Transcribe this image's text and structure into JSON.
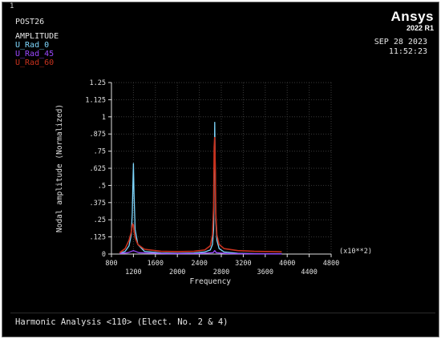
{
  "window_number": "1",
  "post_title": "POST26",
  "amplitude_label": "AMPLITUDE",
  "legend": [
    {
      "label": "U_Rad_0",
      "color": "#7fd8ff"
    },
    {
      "label": "U_Rad_45",
      "color": "#9b48ff"
    },
    {
      "label": "U_Rad_60",
      "color": "#c8321e"
    }
  ],
  "date": "SEP 28 2023",
  "time": "11:52:23",
  "logo": {
    "word": "Ansys",
    "version": "2022 R1"
  },
  "footer": "Harmonic Analysis <110> (Elect. No. 2 & 4)",
  "chart_data": {
    "type": "line",
    "xlabel": "Frequency",
    "ylabel": "Nodal amplitude (Normalized)",
    "x_multiplier": "(x10**2)",
    "xlim": [
      8,
      48
    ],
    "ylim": [
      0,
      1.25
    ],
    "x_ticks_lower": [
      "800",
      "1600",
      "2400",
      "3200",
      "4000",
      "4800"
    ],
    "x_ticks_upper": [
      "1200",
      "2000",
      "2800",
      "3600",
      "4400"
    ],
    "y_ticks": [
      "0",
      ".125",
      ".25",
      ".375",
      ".5",
      ".625",
      ".75",
      ".875",
      "1",
      "1.125",
      "1.25"
    ],
    "grid": true,
    "series": [
      {
        "name": "U_Rad_0",
        "color": "#7fd8ff",
        "x": [
          9.5,
          10.5,
          11.2,
          11.6,
          11.8,
          11.9,
          12.0,
          12.1,
          12.3,
          12.8,
          14,
          17,
          20,
          23,
          25,
          26.0,
          26.4,
          26.6,
          26.7,
          26.8,
          26.9,
          27.0,
          27.2,
          27.6,
          28.5,
          31,
          34,
          37,
          39
        ],
        "y": [
          0.005,
          0.02,
          0.06,
          0.14,
          0.3,
          0.5,
          0.66,
          0.45,
          0.18,
          0.07,
          0.02,
          0.008,
          0.006,
          0.008,
          0.015,
          0.03,
          0.07,
          0.18,
          0.5,
          0.96,
          0.6,
          0.25,
          0.1,
          0.04,
          0.015,
          0.006,
          0.003,
          0.002,
          0.001
        ]
      },
      {
        "name": "U_Rad_45",
        "color": "#9b48ff",
        "x": [
          9.5,
          11,
          12,
          13,
          18,
          24,
          26.5,
          26.8,
          27.1,
          29,
          34,
          39
        ],
        "y": [
          0.004,
          0.01,
          0.025,
          0.01,
          0.003,
          0.004,
          0.01,
          0.025,
          0.01,
          0.004,
          0.002,
          0.001
        ]
      },
      {
        "name": "U_Rad_60",
        "color": "#c8321e",
        "x": [
          9.5,
          10.5,
          11.2,
          11.6,
          11.8,
          11.9,
          12.0,
          12.1,
          12.3,
          12.8,
          14,
          17,
          20,
          23,
          25,
          26.0,
          26.4,
          26.6,
          26.7,
          26.8,
          26.9,
          27.0,
          27.2,
          27.6,
          28.5,
          31,
          34,
          37,
          39
        ],
        "y": [
          0.01,
          0.04,
          0.1,
          0.16,
          0.21,
          0.22,
          0.21,
          0.17,
          0.12,
          0.07,
          0.035,
          0.02,
          0.018,
          0.02,
          0.03,
          0.06,
          0.14,
          0.35,
          0.78,
          0.85,
          0.62,
          0.3,
          0.14,
          0.07,
          0.04,
          0.025,
          0.02,
          0.018,
          0.016
        ]
      }
    ]
  }
}
